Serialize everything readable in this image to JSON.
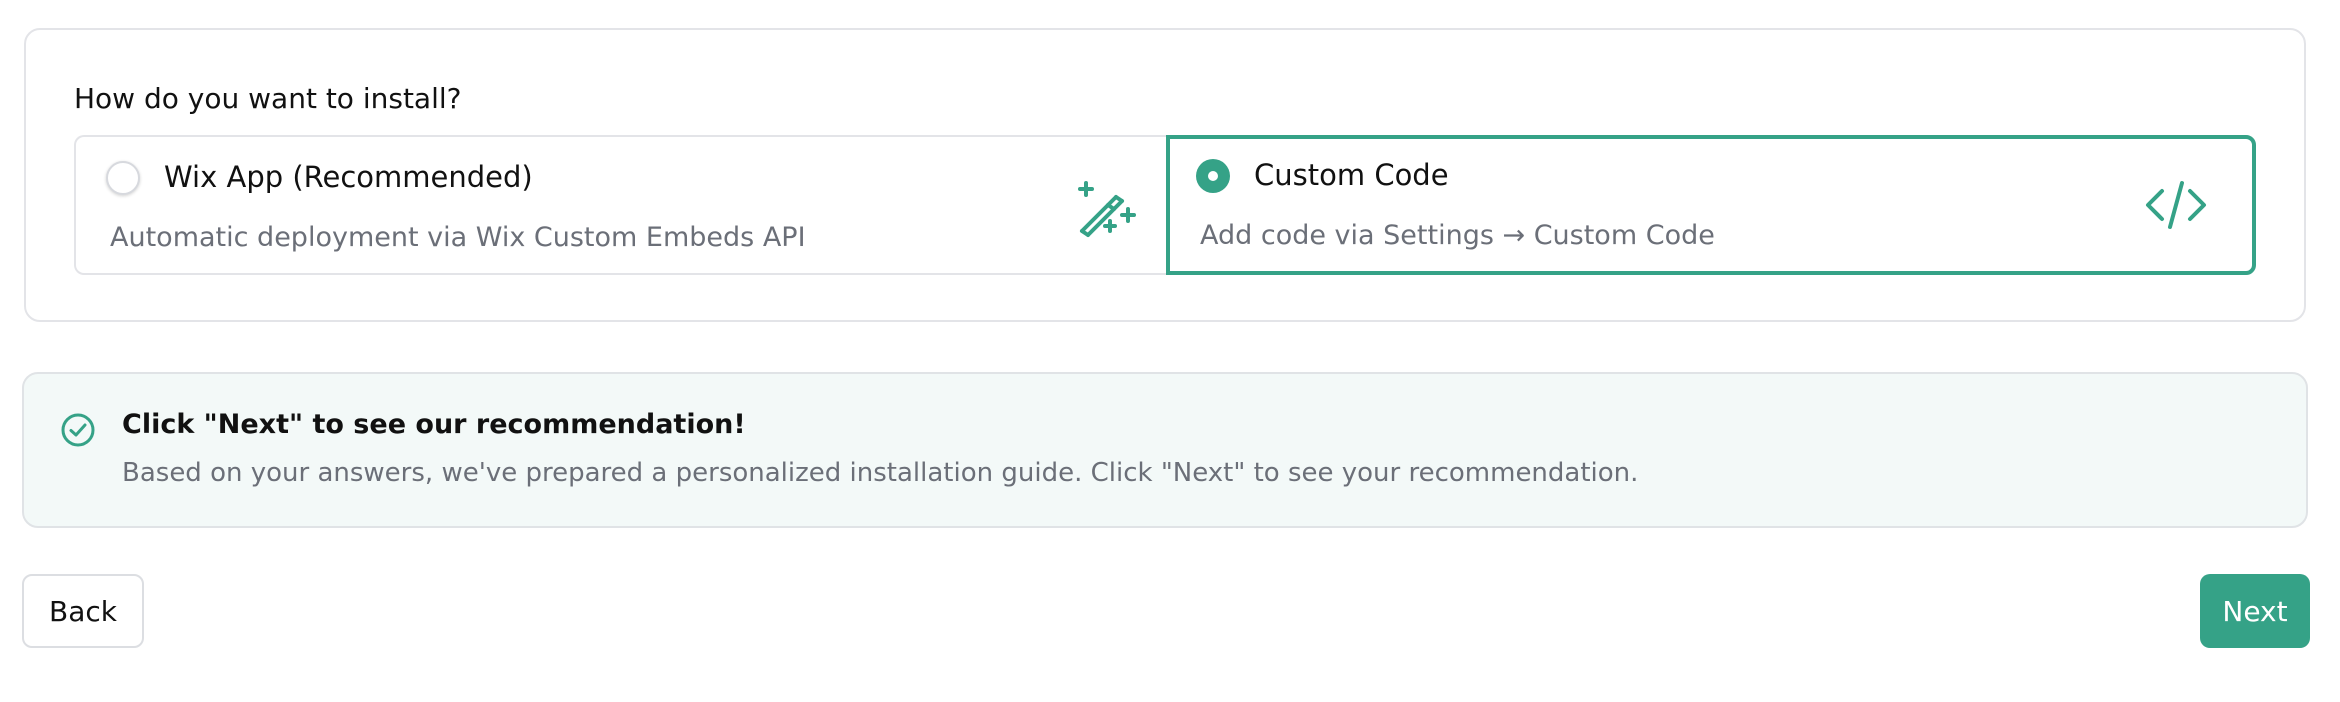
{
  "install": {
    "question": "How do you want to install?",
    "options": [
      {
        "title": "Wix App (Recommended)",
        "description": "Automatic deployment via Wix Custom Embeds API",
        "icon": "magic-wand-icon",
        "selected": false
      },
      {
        "title": "Custom Code",
        "description": "Add code via Settings → Custom Code",
        "icon": "code-icon",
        "selected": true
      }
    ]
  },
  "notice": {
    "icon": "check-circle-icon",
    "title": "Click \"Next\" to see our recommendation!",
    "text": "Based on your answers, we've prepared a personalized installation guide. Click \"Next\" to see your recommendation."
  },
  "footer": {
    "back_label": "Back",
    "next_label": "Next"
  },
  "colors": {
    "accent": "#35a287",
    "border": "#e3e4e8",
    "notice_bg": "#f3f9f8",
    "muted_text": "#6b6f78"
  }
}
